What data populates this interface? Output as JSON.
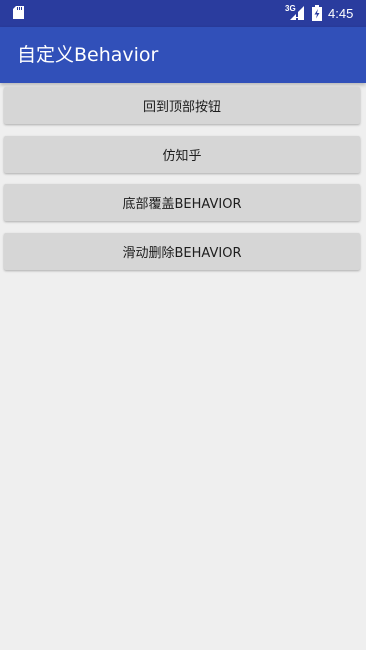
{
  "status_bar": {
    "network": "3G",
    "time": "4:45",
    "icons": [
      "sd-card-icon",
      "signal-icon",
      "battery-charging-icon"
    ]
  },
  "app_bar": {
    "title": "自定义Behavior"
  },
  "buttons": [
    {
      "label": "回到顶部按钮"
    },
    {
      "label": "仿知乎"
    },
    {
      "label": "底部覆盖BEHAVIOR"
    },
    {
      "label": "滑动删除BEHAVIOR"
    }
  ],
  "colors": {
    "status_bar": "#2a3c9e",
    "app_bar": "#3150b9",
    "background": "#efefef",
    "button": "#d6d6d6",
    "button_text": "#1d1d1d"
  }
}
